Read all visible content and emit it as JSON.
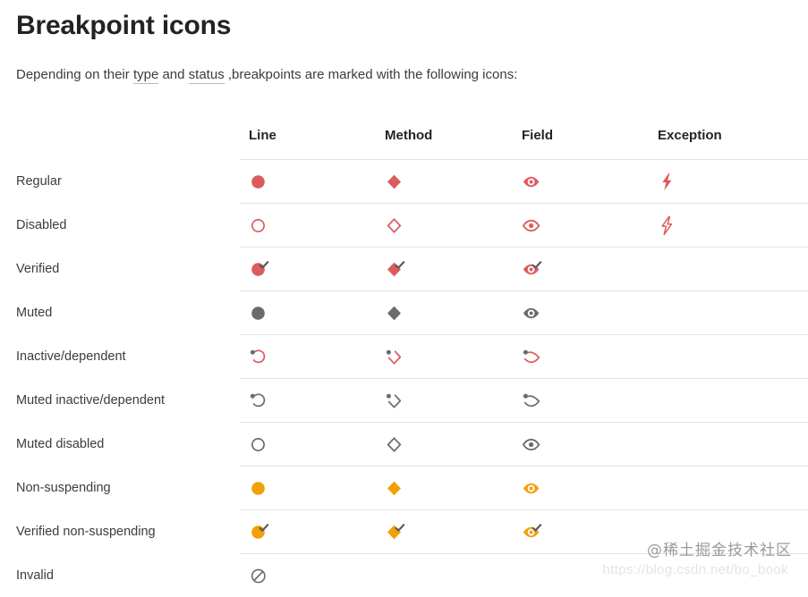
{
  "page": {
    "title": "Breakpoint icons",
    "intro_before": "Depending on their ",
    "intro_link_type": "type",
    "intro_mid": " and ",
    "intro_link_status": "status",
    "intro_after": " ,breakpoints are marked with the following icons:"
  },
  "colors": {
    "red": "#db5b5e",
    "orange": "#f2a007",
    "gray": "#6b6b6b",
    "check": "#5a5a5a",
    "rule": "#e2e2e2",
    "text": "#3c3c3c",
    "heading": "#232323"
  },
  "table": {
    "columns": [
      {
        "key": "label",
        "label": ""
      },
      {
        "key": "line",
        "label": "Line"
      },
      {
        "key": "method",
        "label": "Method"
      },
      {
        "key": "field",
        "label": "Field"
      },
      {
        "key": "exception",
        "label": "Exception"
      }
    ],
    "rows": [
      {
        "label": "Regular",
        "cells": [
          {
            "icon": "circle-filled-red-icon"
          },
          {
            "icon": "diamond-filled-red-icon"
          },
          {
            "icon": "eye-filled-red-icon"
          },
          {
            "icon": "lightning-filled-red-icon"
          }
        ]
      },
      {
        "label": "Disabled",
        "cells": [
          {
            "icon": "circle-outline-red-icon"
          },
          {
            "icon": "diamond-outline-red-icon"
          },
          {
            "icon": "eye-outline-red-icon"
          },
          {
            "icon": "lightning-outline-red-icon"
          }
        ]
      },
      {
        "label": "Verified",
        "cells": [
          {
            "icon": "circle-filled-red-check-icon"
          },
          {
            "icon": "diamond-filled-red-check-icon"
          },
          {
            "icon": "eye-filled-red-check-icon"
          },
          {
            "icon": "none"
          }
        ]
      },
      {
        "label": "Muted",
        "cells": [
          {
            "icon": "circle-filled-gray-icon"
          },
          {
            "icon": "diamond-filled-gray-icon"
          },
          {
            "icon": "eye-filled-gray-icon"
          },
          {
            "icon": "none"
          }
        ]
      },
      {
        "label": "Inactive/dependent",
        "cells": [
          {
            "icon": "circle-outline-red-dot-icon"
          },
          {
            "icon": "diamond-outline-red-dot-icon"
          },
          {
            "icon": "eye-outline-red-dot-icon"
          },
          {
            "icon": "none"
          }
        ]
      },
      {
        "label": "Muted inactive/dependent",
        "cells": [
          {
            "icon": "circle-outline-gray-dot-icon"
          },
          {
            "icon": "diamond-outline-gray-dot-icon"
          },
          {
            "icon": "eye-outline-gray-dot-icon"
          },
          {
            "icon": "none"
          }
        ]
      },
      {
        "label": "Muted disabled",
        "cells": [
          {
            "icon": "circle-outline-gray-icon"
          },
          {
            "icon": "diamond-outline-gray-icon"
          },
          {
            "icon": "eye-outline-gray-icon"
          },
          {
            "icon": "none"
          }
        ]
      },
      {
        "label": "Non-suspending",
        "cells": [
          {
            "icon": "circle-filled-orange-icon"
          },
          {
            "icon": "diamond-filled-orange-icon"
          },
          {
            "icon": "eye-filled-orange-icon"
          },
          {
            "icon": "none"
          }
        ]
      },
      {
        "label": "Verified non-suspending",
        "cells": [
          {
            "icon": "circle-filled-orange-check-icon"
          },
          {
            "icon": "diamond-filled-orange-check-icon"
          },
          {
            "icon": "eye-filled-orange-check-icon"
          },
          {
            "icon": "none"
          }
        ]
      },
      {
        "label": "Invalid",
        "cells": [
          {
            "icon": "prohibition-gray-icon"
          },
          {
            "icon": "none"
          },
          {
            "icon": "none"
          },
          {
            "icon": "none"
          }
        ]
      }
    ]
  },
  "watermark": {
    "text": "@稀土掘金技术社区",
    "url": "https://blog.csdn.net/bo_book"
  }
}
